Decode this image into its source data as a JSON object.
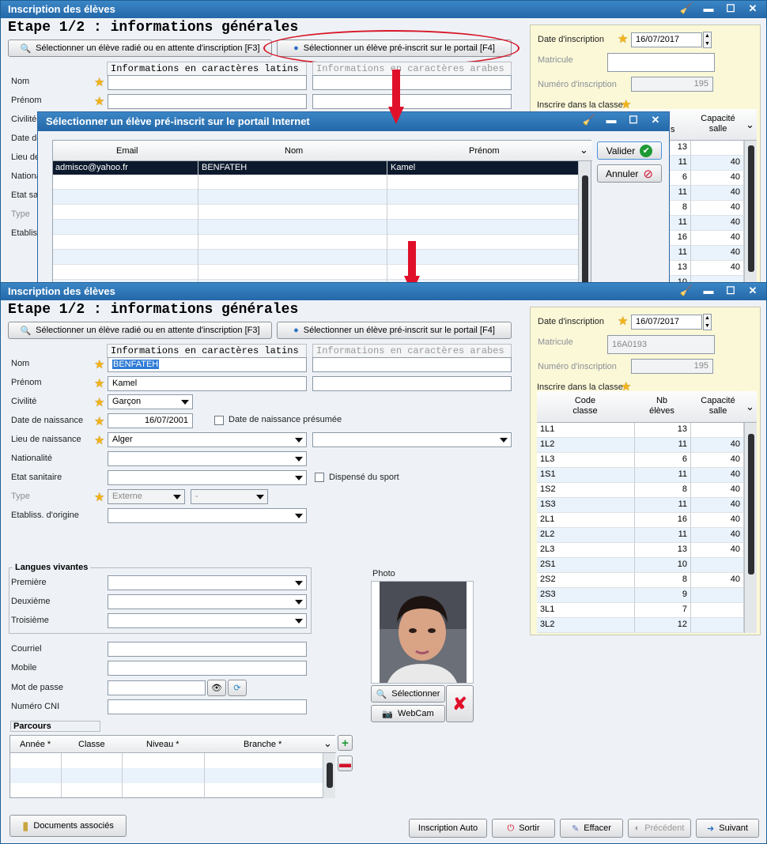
{
  "top_window": {
    "title": "Inscription des élèves",
    "step": "Etape 1/2 : informations générales",
    "btn_radie": "Sélectionner un élève radié ou en attente d'inscription [F3]",
    "btn_portail": "Sélectionner un élève pré-inscrit sur le portail [F4]",
    "hdr_latin": "Informations en caractères latins",
    "hdr_arabe": "Informations en caractères arabes",
    "labels": [
      "Nom",
      "Prénom",
      "Civilité",
      "Date de",
      "Lieu de",
      "Nationa",
      "Etat sa",
      "Type",
      "Etabliss"
    ],
    "right": {
      "date_label": "Date d'inscription",
      "date_value": "16/07/2017",
      "matricule_label": "Matricule",
      "numero_label": "Numéro d'inscription",
      "numero_value": "195",
      "classe_label": "Inscrire dans la classe",
      "col_s": "s",
      "col_capacite": "Capacité salle",
      "rows": [
        {
          "nb": "13",
          "cap": ""
        },
        {
          "nb": "11",
          "cap": "40"
        },
        {
          "nb": "6",
          "cap": "40"
        },
        {
          "nb": "11",
          "cap": "40"
        },
        {
          "nb": "8",
          "cap": "40"
        },
        {
          "nb": "11",
          "cap": "40"
        },
        {
          "nb": "16",
          "cap": "40"
        },
        {
          "nb": "11",
          "cap": "40"
        },
        {
          "nb": "13",
          "cap": "40"
        },
        {
          "nb": "10",
          "cap": ""
        }
      ]
    }
  },
  "dialog": {
    "title": "Sélectionner un élève pré-inscrit sur le portail Internet",
    "col_email": "Email",
    "col_nom": "Nom",
    "col_prenom": "Prénom",
    "row": {
      "email": "admisco@yahoo.fr",
      "nom": "BENFATEH",
      "prenom": "Kamel"
    },
    "valider": "Valider",
    "annuler": "Annuler"
  },
  "bottom_window": {
    "title": "Inscription des élèves",
    "step": "Etape 1/2 : informations générales",
    "btn_radie": "Sélectionner un élève radié ou en attente d'inscription [F3]",
    "btn_portail": "Sélectionner un élève pré-inscrit sur le portail [F4]",
    "hdr_latin": "Informations en caractères latins",
    "hdr_arabe": "Informations en caractères arabes",
    "nom_label": "Nom",
    "nom_value": "BENFATEH",
    "prenom_label": "Prénom",
    "prenom_value": "Kamel",
    "civilite_label": "Civilité",
    "civilite_value": "Garçon",
    "naissance_label": "Date de naissance",
    "naissance_value": "16/07/2001",
    "presumee_label": "Date de naissance présumée",
    "lieu_label": "Lieu de naissance",
    "lieu_value": "Alger",
    "nationalite_label": "Nationalité",
    "sanitaire_label": "Etat sanitaire",
    "dispense_label": "Dispensé du sport",
    "type_label": "Type",
    "type_value": "Externe",
    "type_value2": "-",
    "etablissement_label": "Etabliss. d'origine",
    "langues_title": "Langues vivantes",
    "premiere_label": "Première",
    "deuxieme_label": "Deuxième",
    "troisieme_label": "Troisième",
    "photo_label": "Photo",
    "courriel_label": "Courriel",
    "mobile_label": "Mobile",
    "mdp_label": "Mot de passe",
    "cni_label": "Numéro CNI",
    "selectionner": "Sélectionner",
    "webcam": "WebCam",
    "parcours_title": "Parcours",
    "parcours_cols": [
      "Année *",
      "Classe",
      "Niveau *",
      "Branche *"
    ],
    "right": {
      "date_label": "Date d'inscription",
      "date_value": "16/07/2017",
      "matricule_label": "Matricule",
      "matricule_value": "16A0193",
      "numero_label": "Numéro d'inscription",
      "numero_value": "195",
      "classe_label": "Inscrire dans la classe",
      "col_code": "Code classe",
      "col_nb": "Nb élèves",
      "col_capacite": "Capacité salle",
      "rows": [
        {
          "code": "1L1",
          "nb": "13",
          "cap": ""
        },
        {
          "code": "1L2",
          "nb": "11",
          "cap": "40"
        },
        {
          "code": "1L3",
          "nb": "6",
          "cap": "40"
        },
        {
          "code": "1S1",
          "nb": "11",
          "cap": "40"
        },
        {
          "code": "1S2",
          "nb": "8",
          "cap": "40"
        },
        {
          "code": "1S3",
          "nb": "11",
          "cap": "40"
        },
        {
          "code": "2L1",
          "nb": "16",
          "cap": "40"
        },
        {
          "code": "2L2",
          "nb": "11",
          "cap": "40"
        },
        {
          "code": "2L3",
          "nb": "13",
          "cap": "40"
        },
        {
          "code": "2S1",
          "nb": "10",
          "cap": ""
        },
        {
          "code": "2S2",
          "nb": "8",
          "cap": "40"
        },
        {
          "code": "2S3",
          "nb": "9",
          "cap": ""
        },
        {
          "code": "3L1",
          "nb": "7",
          "cap": ""
        },
        {
          "code": "3L2",
          "nb": "12",
          "cap": ""
        }
      ]
    },
    "footer": {
      "documents": "Documents associés",
      "inscription_auto": "Inscription Auto",
      "sortir": "Sortir",
      "effacer": "Effacer",
      "precedent": "Précédent",
      "suivant": "Suivant"
    }
  }
}
